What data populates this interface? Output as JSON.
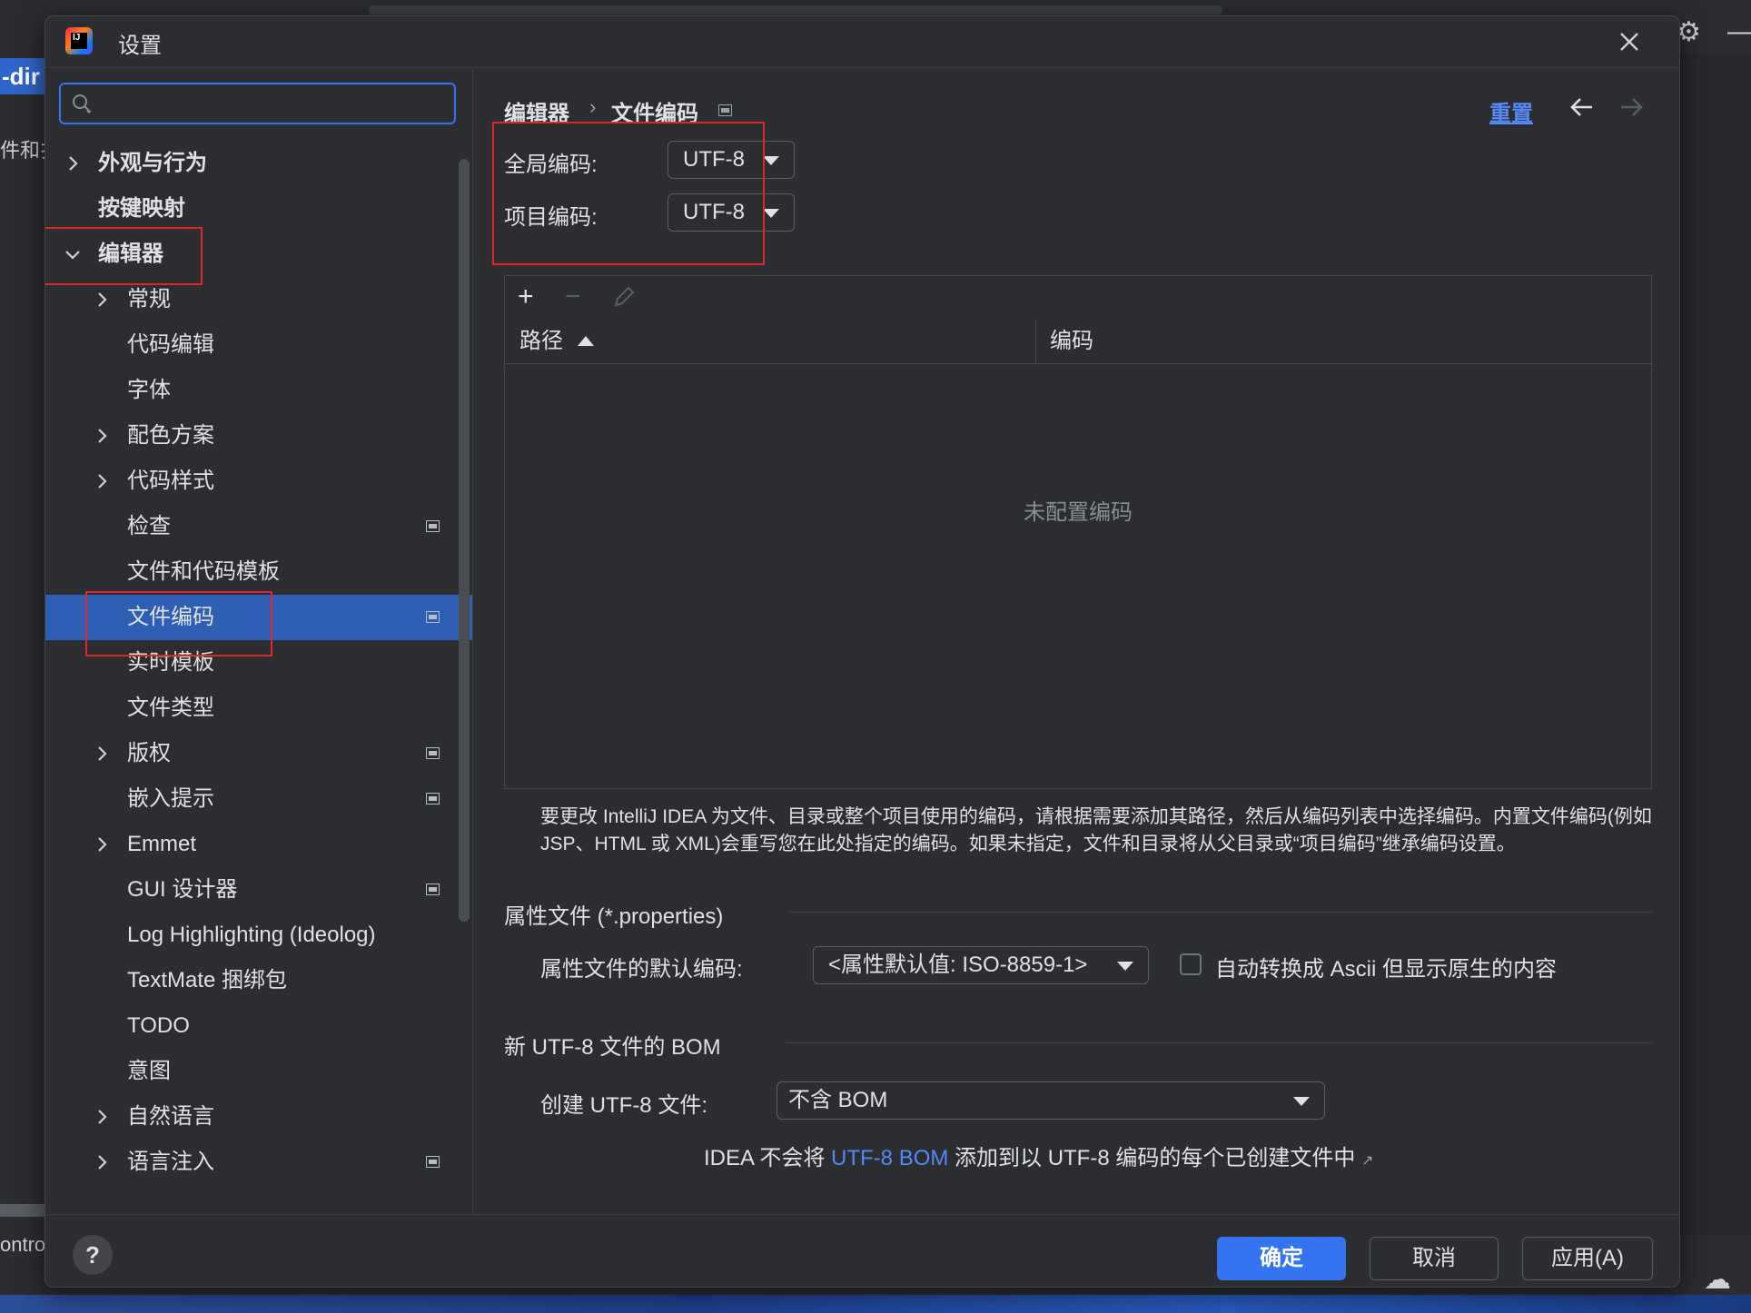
{
  "window": {
    "title": "设置",
    "app_icon_letters": "IJ"
  },
  "background": {
    "left_tab_label": "-dir",
    "left_text": "件和扌",
    "left_bottom_text": "ontro"
  },
  "search": {
    "value": "",
    "placeholder": ""
  },
  "sidebar": {
    "items": [
      {
        "label": "外观与行为",
        "expandable": true,
        "expanded": false,
        "level": 0,
        "bold": true
      },
      {
        "label": "按键映射",
        "expandable": false,
        "level": 0,
        "bold": true
      },
      {
        "label": "编辑器",
        "expandable": true,
        "expanded": true,
        "level": 0,
        "bold": true
      },
      {
        "label": "常规",
        "expandable": true,
        "expanded": false,
        "level": 1
      },
      {
        "label": "代码编辑",
        "expandable": false,
        "level": 1
      },
      {
        "label": "字体",
        "expandable": false,
        "level": 1
      },
      {
        "label": "配色方案",
        "expandable": true,
        "expanded": false,
        "level": 1
      },
      {
        "label": "代码样式",
        "expandable": true,
        "expanded": false,
        "level": 1
      },
      {
        "label": "检查",
        "expandable": false,
        "level": 1,
        "badge": true
      },
      {
        "label": "文件和代码模板",
        "expandable": false,
        "level": 1
      },
      {
        "label": "文件编码",
        "expandable": false,
        "level": 1,
        "badge": true,
        "selected": true
      },
      {
        "label": "实时模板",
        "expandable": false,
        "level": 1
      },
      {
        "label": "文件类型",
        "expandable": false,
        "level": 1
      },
      {
        "label": "版权",
        "expandable": true,
        "expanded": false,
        "level": 1,
        "badge": true
      },
      {
        "label": "嵌入提示",
        "expandable": false,
        "level": 1,
        "badge": true
      },
      {
        "label": "Emmet",
        "expandable": true,
        "expanded": false,
        "level": 1
      },
      {
        "label": "GUI 设计器",
        "expandable": false,
        "level": 1,
        "badge": true
      },
      {
        "label": "Log Highlighting (Ideolog)",
        "expandable": false,
        "level": 1
      },
      {
        "label": "TextMate 捆绑包",
        "expandable": false,
        "level": 1
      },
      {
        "label": "TODO",
        "expandable": false,
        "level": 1
      },
      {
        "label": "意图",
        "expandable": false,
        "level": 1
      },
      {
        "label": "自然语言",
        "expandable": true,
        "expanded": false,
        "level": 1
      },
      {
        "label": "语言注入",
        "expandable": true,
        "expanded": false,
        "level": 1,
        "badge": true
      }
    ]
  },
  "breadcrumb": {
    "parent": "编辑器",
    "separator": "›",
    "current": "文件编码"
  },
  "header_actions": {
    "reset": "重置"
  },
  "encoding": {
    "global_label": "全局编码:",
    "global_value": "UTF-8",
    "project_label": "项目编码:",
    "project_value": "UTF-8"
  },
  "table": {
    "toolbar": {
      "add": "+",
      "remove": "−"
    },
    "columns": [
      "路径",
      "编码"
    ],
    "rows": [],
    "empty_text": "未配置编码"
  },
  "help_text": "要更改 IntelliJ IDEA 为文件、目录或整个项目使用的编码，请根据需要添加其路径，然后从编码列表中选择编码。内置文件编码(例如JSP、HTML 或 XML)会重写您在此处指定的编码。如果未指定，文件和目录将从父目录或“项目编码”继承编码设置。",
  "properties": {
    "section_title": "属性文件 (*.properties)",
    "default_label": "属性文件的默认编码:",
    "default_value": "<属性默认值: ISO-8859-1>",
    "ascii_label": "自动转换成 Ascii 但显示原生的内容",
    "ascii_checked": false
  },
  "bom": {
    "section_title": "新 UTF-8 文件的 BOM",
    "create_label": "创建 UTF-8 文件:",
    "create_value": "不含 BOM",
    "note_prefix": "IDEA 不会将 ",
    "note_link": "UTF-8 BOM",
    "note_suffix": " 添加到以 UTF-8 编码的每个已创建文件中 ",
    "note_icon": "↗"
  },
  "footer": {
    "help": "?",
    "ok": "确定",
    "cancel": "取消",
    "apply": "应用(A)"
  },
  "colors": {
    "accent": "#3574f0",
    "selection": "#2e5fb5",
    "link": "#548af7",
    "highlight_annotation": "#e0262c"
  }
}
